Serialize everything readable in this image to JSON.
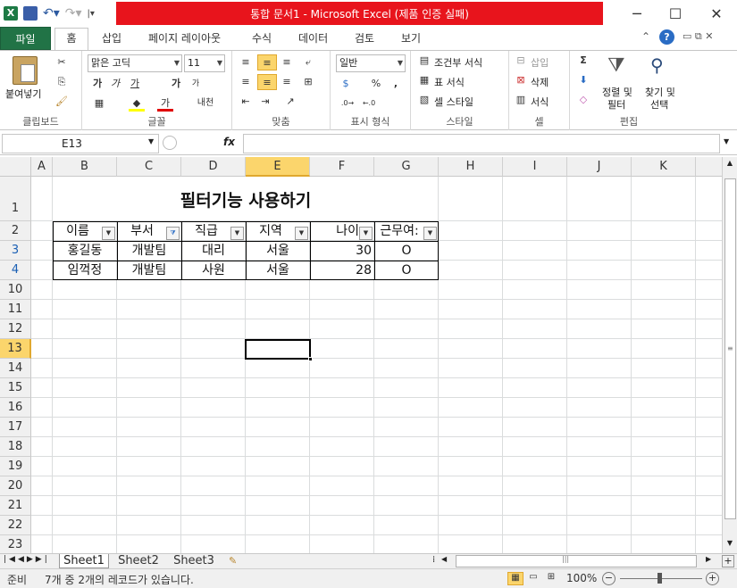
{
  "window": {
    "title": "통합 문서1  -  Microsoft Excel (제품 인증 실패)",
    "title_bg": "#e8141c",
    "minimize_icon": "─",
    "maximize_icon": "☐",
    "close_icon": "✕"
  },
  "ribbon_tabs": [
    "파일",
    "홈",
    "삽입",
    "페이지 레이아웃",
    "수식",
    "데이터",
    "검토",
    "보기"
  ],
  "ribbon": {
    "clipboard": {
      "paste": "붙여넣기",
      "label": "클립보드"
    },
    "font": {
      "name": "맑은 고딕",
      "size": "11",
      "bold": "가",
      "italic": "가",
      "underline": "가",
      "grow": "가",
      "shrink": "가",
      "phonetic": "내천",
      "label": "글꼴"
    },
    "alignment": {
      "label": "맞춤"
    },
    "number": {
      "format": "일반",
      "percent": "%",
      "comma": ",",
      "label": "표시 형식"
    },
    "styles": {
      "conditional": "조건부 서식",
      "table": "표 서식",
      "cell": "셀 스타일",
      "label": "스타일"
    },
    "cells": {
      "insert": "삽입",
      "delete": "삭제",
      "format": "서식",
      "label": "셀"
    },
    "editing": {
      "sort_filter_1": "정렬 및",
      "sort_filter_2": "필터",
      "find_1": "찾기 및",
      "find_2": "선택",
      "label": "편집"
    }
  },
  "formula_bar": {
    "name_box": "E13",
    "fx": "fx",
    "value": ""
  },
  "columns": [
    "A",
    "B",
    "C",
    "D",
    "E",
    "F",
    "G",
    "H",
    "I",
    "J",
    "K"
  ],
  "rows": [
    "1",
    "2",
    "3",
    "4",
    "10",
    "11",
    "12",
    "13",
    "14",
    "15",
    "16",
    "17",
    "18",
    "19",
    "20",
    "21",
    "22",
    "23"
  ],
  "sheet": {
    "title": "필터기능 사용하기",
    "headers": [
      "이름",
      "부서",
      "직급",
      "지역",
      "나이",
      "근무여:"
    ],
    "data": [
      [
        "홍길동",
        "개발팀",
        "대리",
        "서울",
        "30",
        "O"
      ],
      [
        "임꺽정",
        "개발팀",
        "사원",
        "서울",
        "28",
        "O"
      ]
    ]
  },
  "sheet_tabs": [
    "Sheet1",
    "Sheet2",
    "Sheet3"
  ],
  "status": {
    "ready": "준비",
    "message": "7개 중 2개의 레코드가 있습니다.",
    "zoom": "100%"
  }
}
